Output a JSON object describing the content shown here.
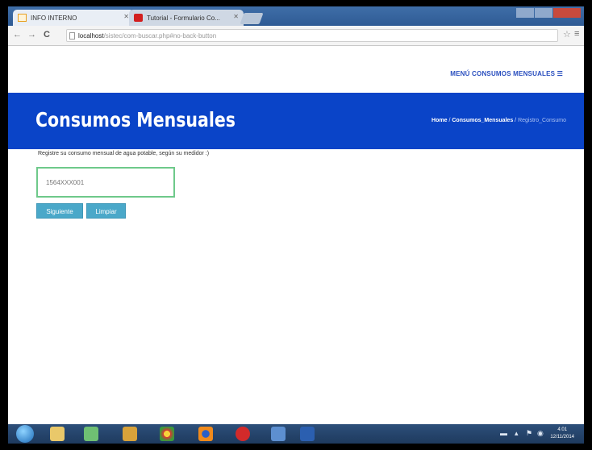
{
  "browser": {
    "tabs": [
      {
        "label": "INFO INTERNO",
        "icon": "page-icon"
      },
      {
        "label": "Tutorial - Formulario Co...",
        "icon": "youtube-icon"
      }
    ],
    "address_host": "localhost",
    "address_path": "/sistec/com-buscar.php#no-back-button"
  },
  "site": {
    "top_menu": "MENÚ CONSUMOS MENSUALES ☰",
    "hero_title": "Consumos Mensuales",
    "breadcrumb": {
      "home": "Home",
      "sep": "/",
      "section": "Consumos_Mensuales",
      "current": "Registro_Consumo"
    },
    "instruction": "Registre su consumo mensual de agua potable, según su medidor :)",
    "meter_field_value": "1564XXX001",
    "buttons": {
      "next": "Siguiente",
      "clear": "Limpiar"
    }
  },
  "taskbar": {
    "time": "4:01",
    "date": "12/11/2014"
  },
  "colors": {
    "hero_bg": "#0a44c8",
    "button_bg": "#4aa8c9",
    "field_border": "#6ec98a",
    "top_menu": "#2a4fbf"
  }
}
